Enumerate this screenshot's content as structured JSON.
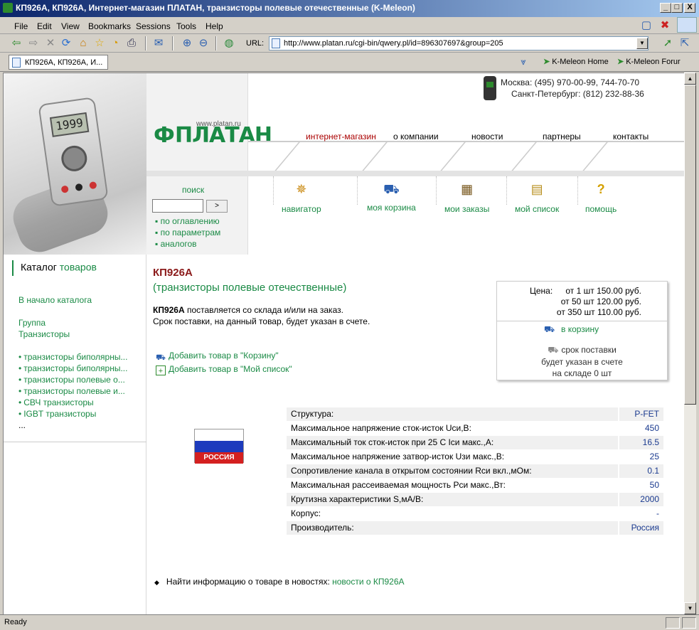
{
  "window": {
    "title": "КП926А, КП926А, Интернет-магазин ПЛАТАН, транзисторы полевые отечественные (K-Meleon)",
    "minimize": "_",
    "maximize": "□",
    "close": "X"
  },
  "menu": [
    "File",
    "Edit",
    "View",
    "Bookmarks",
    "Sessions",
    "Tools",
    "Help"
  ],
  "toolbar": {
    "url_label": "URL:",
    "url": "http://www.platan.ru/cgi-bin/qwery.pl/id=896307697&group=205"
  },
  "tabs": [
    {
      "label": "КП926А, КП926А, И..."
    }
  ],
  "bookmarks": [
    "K-Meleon Home",
    "K-Meleon Forur"
  ],
  "status": "Ready",
  "site": {
    "logo_url": "www.platan.ru",
    "logo_text": "ПЛАТАН",
    "phone_moscow": "Москва:  (495) 970-00-99, 744-70-70",
    "phone_spb": "Санкт-Петербург:  (812) 232-88-36",
    "nav": [
      "интернет-магазин",
      "о компании",
      "новости",
      "партнеры",
      "контакты"
    ],
    "search_label": "поиск",
    "search_button": ">",
    "search_links": [
      "по оглавлению",
      "по параметрам",
      "аналогов"
    ],
    "tools": [
      "навигатор",
      "моя корзина",
      "мои заказы",
      "мой список",
      "помощь"
    ]
  },
  "catalog": {
    "title_part1": "Каталог",
    "title_part2": "товаров",
    "home_link": "В начало каталога",
    "group_label": "Группа",
    "group_value": "Транзисторы",
    "items": [
      "транзисторы биполярны...",
      "транзисторы биполярны...",
      "транзисторы полевые о...",
      "транзисторы полевые и...",
      "СВЧ транзисторы",
      "IGBT транзисторы",
      "..."
    ]
  },
  "product": {
    "name": "КП926А",
    "category": "(транзисторы полевые отечественные)",
    "avail_bold": "КП926А",
    "avail_rest": " поставляется со склада и/или на заказ.",
    "delivery_note": "Срок поставки, на данный товар, будет указан в счете.",
    "add_cart": "Добавить товар в \"Корзину\"",
    "add_list": "Добавить товар в \"Мой список\"",
    "country": "РОССИЯ"
  },
  "price": {
    "label": "Цена:",
    "rows": [
      "от 1 шт 150.00 руб.",
      "от 50 шт 120.00 руб.",
      "от 350 шт 110.00 руб."
    ],
    "cart_link": "в корзину",
    "delivery_line1": "срок поставки",
    "delivery_line2": "будет указан в счете",
    "delivery_line3": "на складе 0 шт"
  },
  "specs": [
    {
      "key": "Структура:",
      "value": "P-FET"
    },
    {
      "key": "Максимальное напряжение сток-исток Uси,В:",
      "value": "450"
    },
    {
      "key": "Максимальный ток сток-исток при 25 С Iси макс.,А:",
      "value": "16.5"
    },
    {
      "key": "Максимальное напряжение затвор-исток Uзи макс.,В:",
      "value": "25"
    },
    {
      "key": "Сопротивление канала в открытом состоянии Rси вкл.,мОм:",
      "value": "0.1"
    },
    {
      "key": "Максимальная рассеиваемая мощность Pси макс.,Вт:",
      "value": "50"
    },
    {
      "key": "Крутизна характеристики S,мА/В:",
      "value": "2000"
    },
    {
      "key": "Корпус:",
      "value": "-"
    },
    {
      "key": "Производитель:",
      "value": "Россия"
    }
  ],
  "news": {
    "prefix": "Найти информацию о товаре в новостях:",
    "link": "новости о КП926А"
  },
  "colors": {
    "accent": "#1a8a45",
    "title_red": "#8b1a1a",
    "value_blue": "#1a3a8f"
  }
}
